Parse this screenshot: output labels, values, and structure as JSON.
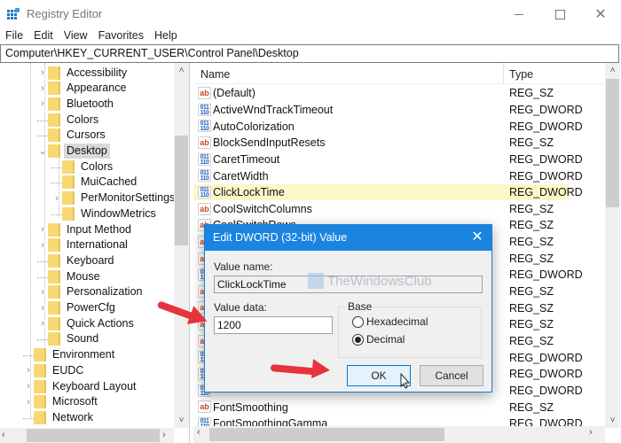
{
  "window": {
    "title": "Registry Editor",
    "controls": {
      "minimize": "minimize",
      "maximize": "maximize",
      "close": "✕"
    }
  },
  "menu": [
    "File",
    "Edit",
    "View",
    "Favorites",
    "Help"
  ],
  "address": "Computer\\HKEY_CURRENT_USER\\Control Panel\\Desktop",
  "tree": [
    {
      "label": "Accessibility",
      "level": 2,
      "expander": "collapsed"
    },
    {
      "label": "Appearance",
      "level": 2,
      "expander": "collapsed"
    },
    {
      "label": "Bluetooth",
      "level": 2,
      "expander": "collapsed"
    },
    {
      "label": "Colors",
      "level": 2,
      "expander": "none"
    },
    {
      "label": "Cursors",
      "level": 2,
      "expander": "none"
    },
    {
      "label": "Desktop",
      "level": 2,
      "expander": "expanded",
      "selected": true
    },
    {
      "label": "Colors",
      "level": 3,
      "expander": "none"
    },
    {
      "label": "MuiCached",
      "level": 3,
      "expander": "none"
    },
    {
      "label": "PerMonitorSettings",
      "level": 3,
      "expander": "collapsed"
    },
    {
      "label": "WindowMetrics",
      "level": 3,
      "expander": "none"
    },
    {
      "label": "Input Method",
      "level": 2,
      "expander": "collapsed"
    },
    {
      "label": "International",
      "level": 2,
      "expander": "collapsed"
    },
    {
      "label": "Keyboard",
      "level": 2,
      "expander": "none"
    },
    {
      "label": "Mouse",
      "level": 2,
      "expander": "none"
    },
    {
      "label": "Personalization",
      "level": 2,
      "expander": "collapsed"
    },
    {
      "label": "PowerCfg",
      "level": 2,
      "expander": "collapsed"
    },
    {
      "label": "Quick Actions",
      "level": 2,
      "expander": "collapsed"
    },
    {
      "label": "Sound",
      "level": 2,
      "expander": "none"
    },
    {
      "label": "Environment",
      "level": 1,
      "expander": "none"
    },
    {
      "label": "EUDC",
      "level": 1,
      "expander": "collapsed"
    },
    {
      "label": "Keyboard Layout",
      "level": 1,
      "expander": "collapsed"
    },
    {
      "label": "Microsoft",
      "level": 1,
      "expander": "collapsed"
    },
    {
      "label": "Network",
      "level": 1,
      "expander": "none"
    }
  ],
  "list": {
    "headers": {
      "name": "Name",
      "type": "Type"
    },
    "rows": [
      {
        "name": "(Default)",
        "type": "REG_SZ",
        "icon": "sz"
      },
      {
        "name": "ActiveWndTrackTimeout",
        "type": "REG_DWORD",
        "icon": "dword"
      },
      {
        "name": "AutoColorization",
        "type": "REG_DWORD",
        "icon": "dword"
      },
      {
        "name": "BlockSendInputResets",
        "type": "REG_SZ",
        "icon": "sz"
      },
      {
        "name": "CaretTimeout",
        "type": "REG_DWORD",
        "icon": "dword"
      },
      {
        "name": "CaretWidth",
        "type": "REG_DWORD",
        "icon": "dword"
      },
      {
        "name": "ClickLockTime",
        "type": "REG_DWORD",
        "icon": "dword",
        "highlight": true
      },
      {
        "name": "CoolSwitchColumns",
        "type": "REG_SZ",
        "icon": "sz"
      },
      {
        "name": "CoolSwitchRows",
        "type": "REG_SZ",
        "icon": "sz"
      },
      {
        "name": "",
        "type": "REG_SZ",
        "icon": "sz"
      },
      {
        "name": "",
        "type": "REG_SZ",
        "icon": "sz"
      },
      {
        "name": "",
        "type": "REG_DWORD",
        "icon": "dword"
      },
      {
        "name": "",
        "type": "REG_SZ",
        "icon": "sz"
      },
      {
        "name": "",
        "type": "REG_SZ",
        "icon": "sz"
      },
      {
        "name": "",
        "type": "REG_SZ",
        "icon": "sz"
      },
      {
        "name": "",
        "type": "REG_SZ",
        "icon": "sz"
      },
      {
        "name": "",
        "type": "REG_DWORD",
        "icon": "dword"
      },
      {
        "name": "",
        "type": "REG_DWORD",
        "icon": "dword"
      },
      {
        "name": "",
        "type": "REG_DWORD",
        "icon": "dword"
      },
      {
        "name": "FontSmoothing",
        "type": "REG_SZ",
        "icon": "sz"
      },
      {
        "name": "FontSmoothingGamma",
        "type": "REG_DWORD",
        "icon": "dword"
      }
    ]
  },
  "dialog": {
    "title": "Edit DWORD (32-bit) Value",
    "value_name_label": "Value name:",
    "value_name": "ClickLockTime",
    "value_data_label": "Value data:",
    "value_data": "1200",
    "base_label": "Base",
    "base_options": [
      {
        "label": "Hexadecimal",
        "checked": false
      },
      {
        "label": "Decimal",
        "checked": true
      }
    ],
    "ok_label": "OK",
    "cancel_label": "Cancel",
    "close_icon": "✕"
  },
  "watermark": "TheWindowsClub",
  "icons": {
    "sz": "ab",
    "dword": "011\n110",
    "chevron_collapsed": "›",
    "chevron_expanded": "⌄",
    "scroll_up": "˄",
    "scroll_down": "˅",
    "scroll_left": "‹",
    "scroll_right": "›"
  },
  "colors": {
    "accent": "#1a84e0",
    "highlight_row": "#fcf8c8",
    "annotation_arrow": "#e8323c",
    "folder": "#f8d775"
  }
}
